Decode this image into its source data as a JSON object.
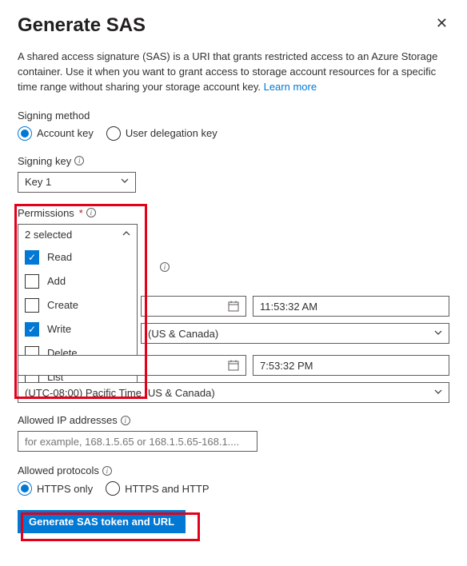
{
  "header": {
    "title": "Generate SAS"
  },
  "description": {
    "text_a": "A shared access signature (SAS) is a URI that grants restricted access to an Azure Storage container. Use it when you want to grant access to storage account resources for a specific time range without sharing your storage account key. ",
    "learn_more": "Learn more"
  },
  "signing_method": {
    "label": "Signing method",
    "options": {
      "account_key": "Account key",
      "user_delegation": "User delegation key"
    },
    "selected": "account_key"
  },
  "signing_key": {
    "label": "Signing key",
    "value": "Key 1"
  },
  "permissions": {
    "label": "Permissions",
    "summary": "2 selected",
    "options": [
      {
        "label": "Read",
        "checked": true
      },
      {
        "label": "Add",
        "checked": false
      },
      {
        "label": "Create",
        "checked": false
      },
      {
        "label": "Write",
        "checked": true
      },
      {
        "label": "Delete",
        "checked": false
      },
      {
        "label": "List",
        "checked": false
      }
    ]
  },
  "start": {
    "time": "11:53:32 AM",
    "tz_partial": "(US & Canada)"
  },
  "expiry": {
    "time": "7:53:32 PM",
    "tz_full": "(UTC-08:00) Pacific Time (US & Canada)"
  },
  "allowed_ip": {
    "label": "Allowed IP addresses",
    "placeholder": "for example, 168.1.5.65 or 168.1.5.65-168.1...."
  },
  "allowed_protocols": {
    "label": "Allowed protocols",
    "options": {
      "https_only": "HTTPS only",
      "both": "HTTPS and HTTP"
    },
    "selected": "https_only"
  },
  "generate_button": "Generate SAS token and URL"
}
